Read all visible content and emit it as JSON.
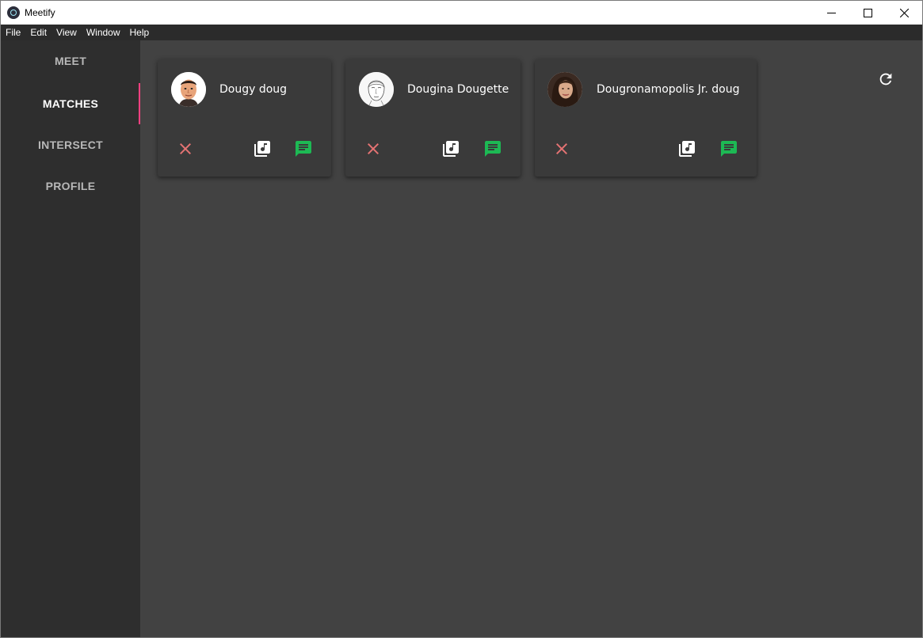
{
  "window": {
    "title": "Meetify",
    "controls": [
      "minimize-icon",
      "maximize-icon",
      "close-icon"
    ]
  },
  "menu": [
    "File",
    "Edit",
    "View",
    "Window",
    "Help"
  ],
  "sidebar": {
    "items": [
      {
        "label": "MEET",
        "active": false
      },
      {
        "label": "MATCHES",
        "active": true
      },
      {
        "label": "INTERSECT",
        "active": false
      },
      {
        "label": "PROFILE",
        "active": false
      }
    ],
    "active_indicator_color": "#ff4081"
  },
  "main": {
    "refresh_icon": "refresh-icon",
    "matches": [
      {
        "name": "Dougy doug",
        "avatar": "cartoon-man-avatar"
      },
      {
        "name": "Dougina Dougette",
        "avatar": "sketch-face-avatar"
      },
      {
        "name": "Dougronamopolis Jr. doug",
        "avatar": "photo-woman-avatar"
      }
    ],
    "actions": {
      "remove_icon": "close-x-icon",
      "remove_color": "#e57373",
      "music_icon": "music-library-icon",
      "message_icon": "chat-message-icon",
      "message_color": "#1db954"
    }
  }
}
